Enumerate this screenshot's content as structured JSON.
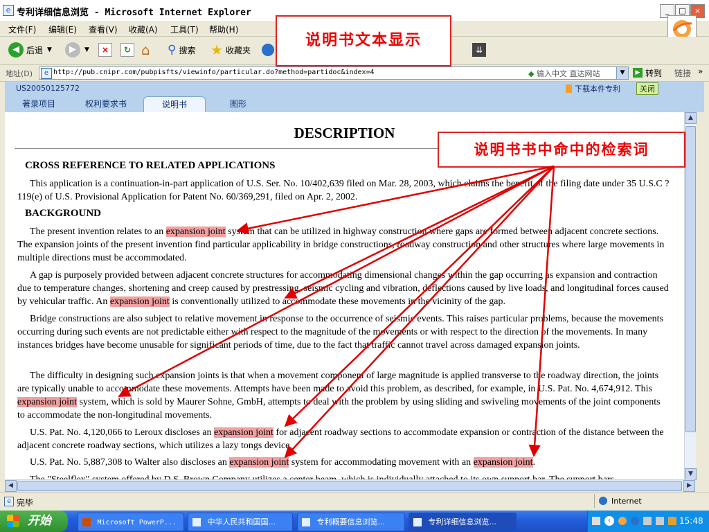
{
  "window": {
    "title": "专利详细信息浏览 - Microsoft Internet Explorer"
  },
  "menu": [
    "文件(F)",
    "编辑(E)",
    "查看(V)",
    "收藏(A)",
    "工具(T)",
    "帮助(H)"
  ],
  "toolbar": {
    "back": "后退",
    "search": "搜索",
    "favorites": "收藏夹"
  },
  "address": {
    "label": "地址(D)",
    "url": "http://pub.cnipr.com/pubpisfts/viewinfo/particular.do?method=partidoc&index=4",
    "input_hint": "输入中文 直达网站",
    "go": "转到",
    "links": "链接"
  },
  "page": {
    "patent_number": "US20050125772",
    "download": "下载本件专利",
    "close": "关闭",
    "tabs": [
      "著录项目",
      "权利要求书",
      "说明书",
      "图形"
    ],
    "active_tab": "说明书"
  },
  "doc": {
    "title": "DESCRIPTION",
    "h1": "CROSS REFERENCE TO RELATED APPLICATIONS",
    "p1": "This application is a continuation-in-part application of U.S. Ser. No. 10/402,639 filed on Mar. 28, 2003, which claims the benefit of the filing date under 35 U.S.C ?119(e) of U.S. Provisional Application for Patent No. 60/369,291, filed on Apr. 2, 2002.",
    "h2": "BACKGROUND",
    "hit": "expansion joint",
    "p2a": "The present invention relates to an ",
    "p2b": " system that can be utilized in highway construction where gaps are formed between adjacent concrete sections. The expansion joints of the present invention find particular applicability in bridge constructions, roadway construction and other structures where large movements in multiple directions must be accommodated.",
    "p3a": "A gap is purposely provided between adjacent concrete structures for accommodating dimensional changes within the gap occurring as expansion and contraction due to temperature changes, shortening and creep caused by prestressing, seismic cycling and vibration, deflections caused by live loads, and longitudinal forces caused by vehicular traffic. An ",
    "p3b": " is conventionally utilized to accommodate these movements in the vicinity of the gap.",
    "p4": "Bridge constructions are also subject to relative movement in response to the occurrence of seismic events. This raises particular problems, because the movements occurring during such events are not predictable either with respect to the magnitude of the movements or with respect to the direction of the movements. In many instances bridges have become unusable for significant periods of time, due to the fact that traffic cannot travel across damaged expansion joints.",
    "p5a": "The difficulty in designing such expansion joints is that when a movement component of large magnitude is applied transverse to the roadway direction, the joints are typically unable to accommodate these movements. Attempts have been made to avoid this problem, as described, for example, in U.S. Pat. No. 4,674,912. This ",
    "p5b": " system, which is sold by Maurer Sohne, GmbH, attempts to deal with the problem by using sliding and swiveling movements of the joint components to accommodate the non-longitudinal movements.",
    "p6a": "U.S. Pat. No. 4,120,066 to Leroux discloses an ",
    "p6b": " for adjacent roadway sections to accommodate expansion or contraction of the distance between the adjacent concrete roadway sections, which utilizes a lazy tongs device.",
    "p7a": "U.S. Pat. No. 5,887,308 to Walter also discloses an ",
    "p7b": " system for accommodating movement with an ",
    "p7c": ".",
    "p8": "The \"Steelflex\" system offered by D.S. Brown Company utilizes a center beam, which is individually attached to its own support bar. The support bars"
  },
  "status": {
    "text": "完毕",
    "zone": "Internet"
  },
  "taskbar": {
    "start": "开始",
    "tasks": [
      "Microsoft PowerP...",
      "中华人民共和国国...",
      "专利概要信息浏览...",
      "专利详细信息浏览..."
    ],
    "clock": "15:48"
  },
  "annotations": {
    "top": "说明书文本显示",
    "right": "说明书书中命中的检索词"
  },
  "colors": {
    "highlight": "#f0a0a0",
    "annotation": "#e00000"
  }
}
